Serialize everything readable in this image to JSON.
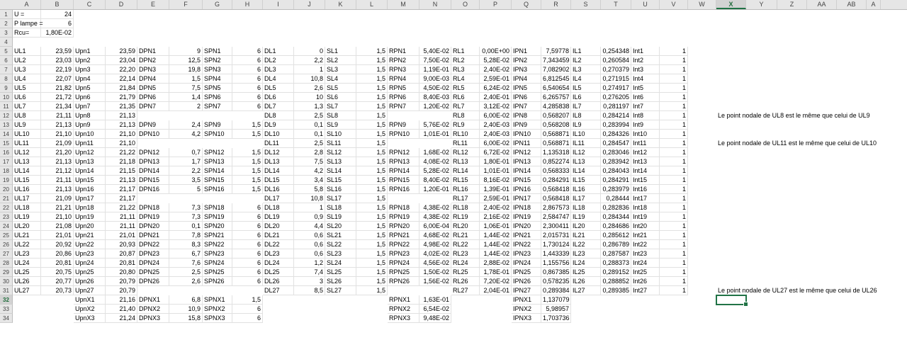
{
  "columns": [
    "A",
    "B",
    "C",
    "D",
    "E",
    "F",
    "G",
    "H",
    "I",
    "J",
    "K",
    "L",
    "M",
    "N",
    "O",
    "P",
    "Q",
    "R",
    "S",
    "T",
    "U",
    "V",
    "W",
    "X",
    "Y",
    "Z",
    "AA",
    "AB",
    "A"
  ],
  "selected_cell": "X32",
  "notes": {
    "r12": "Le point nodale de UL8 est le même que celui de UL9",
    "r15": "Le point nodale de UL11 est le même que celui de UL10",
    "r31": "Le point nodale de UL27 est le même que celui de UL26"
  },
  "rows": [
    {
      "n": "1",
      "c": [
        "U =",
        "24"
      ]
    },
    {
      "n": "2",
      "c": [
        "P lampe =",
        "6"
      ]
    },
    {
      "n": "3",
      "c": [
        "Rcu=",
        "1,80E-02"
      ]
    },
    {
      "n": "4",
      "c": []
    },
    {
      "n": "5",
      "c": [
        "UL1",
        "23,59",
        "Upn1",
        "23,59",
        "DPN1",
        "9",
        "SPN1",
        "6",
        "DL1",
        "0",
        "SL1",
        "1,5",
        "RPN1",
        "5,40E-02",
        "RL1",
        "0,00E+00",
        "IPN1",
        "7,59778",
        "IL1",
        "0,254348",
        "Int1",
        "1"
      ]
    },
    {
      "n": "6",
      "c": [
        "UL2",
        "23,03",
        "Upn2",
        "23,04",
        "DPN2",
        "12,5",
        "SPN2",
        "6",
        "DL2",
        "2,2",
        "SL2",
        "1,5",
        "RPN2",
        "7,50E-02",
        "RL2",
        "5,28E-02",
        "IPN2",
        "7,343459",
        "IL2",
        "0,260584",
        "Int2",
        "1"
      ]
    },
    {
      "n": "7",
      "c": [
        "UL3",
        "22,19",
        "Upn3",
        "22,20",
        "DPN3",
        "19,8",
        "SPN3",
        "6",
        "DL3",
        "1",
        "SL3",
        "1,5",
        "RPN3",
        "1,19E-01",
        "RL3",
        "2,40E-02",
        "IPN3",
        "7,082902",
        "IL3",
        "0,270379",
        "Int3",
        "1"
      ]
    },
    {
      "n": "8",
      "c": [
        "UL4",
        "22,07",
        "Upn4",
        "22,14",
        "DPN4",
        "1,5",
        "SPN4",
        "6",
        "DL4",
        "10,8",
        "SL4",
        "1,5",
        "RPN4",
        "9,00E-03",
        "RL4",
        "2,59E-01",
        "IPN4",
        "6,812545",
        "IL4",
        "0,271915",
        "Int4",
        "1"
      ]
    },
    {
      "n": "9",
      "c": [
        "UL5",
        "21,82",
        "Upn5",
        "21,84",
        "DPN5",
        "7,5",
        "SPN5",
        "6",
        "DL5",
        "2,6",
        "SL5",
        "1,5",
        "RPN5",
        "4,50E-02",
        "RL5",
        "6,24E-02",
        "IPN5",
        "6,540654",
        "IL5",
        "0,274917",
        "Int5",
        "1"
      ]
    },
    {
      "n": "10",
      "c": [
        "UL6",
        "21,72",
        "Upn6",
        "21,79",
        "DPN6",
        "1,4",
        "SPN6",
        "6",
        "DL6",
        "10",
        "SL6",
        "1,5",
        "RPN6",
        "8,40E-03",
        "RL6",
        "2,40E-01",
        "IPN6",
        "6,265757",
        "IL6",
        "0,276205",
        "Int6",
        "1"
      ]
    },
    {
      "n": "11",
      "c": [
        "UL7",
        "21,34",
        "Upn7",
        "21,35",
        "DPN7",
        "2",
        "SPN7",
        "6",
        "DL7",
        "1,3",
        "SL7",
        "1,5",
        "RPN7",
        "1,20E-02",
        "RL7",
        "3,12E-02",
        "IPN7",
        "4,285838",
        "IL7",
        "0,281197",
        "Int7",
        "1"
      ]
    },
    {
      "n": "12",
      "c": [
        "UL8",
        "21,11",
        "Upn8",
        "21,13",
        "",
        "",
        "",
        "",
        "DL8",
        "2,5",
        "SL8",
        "1,5",
        "",
        "",
        "RL8",
        "6,00E-02",
        "IPN8",
        "0,568207",
        "IL8",
        "0,284214",
        "Int8",
        "1"
      ]
    },
    {
      "n": "13",
      "c": [
        "UL9",
        "21,13",
        "Upn9",
        "21,13",
        "DPN9",
        "2,4",
        "SPN9",
        "1,5",
        "DL9",
        "0,1",
        "SL9",
        "1,5",
        "RPN9",
        "5,76E-02",
        "RL9",
        "2,40E-03",
        "IPN9",
        "0,568208",
        "IL9",
        "0,283994",
        "Int9",
        "1"
      ]
    },
    {
      "n": "14",
      "c": [
        "UL10",
        "21,10",
        "Upn10",
        "21,10",
        "DPN10",
        "4,2",
        "SPN10",
        "1,5",
        "DL10",
        "0,1",
        "SL10",
        "1,5",
        "RPN10",
        "1,01E-01",
        "RL10",
        "2,40E-03",
        "IPN10",
        "0,568871",
        "IL10",
        "0,284326",
        "Int10",
        "1"
      ]
    },
    {
      "n": "15",
      "c": [
        "UL11",
        "21,09",
        "Upn11",
        "21,10",
        "",
        "",
        "",
        "",
        "DL11",
        "2,5",
        "SL11",
        "1,5",
        "",
        "",
        "RL11",
        "6,00E-02",
        "IPN11",
        "0,568871",
        "IL11",
        "0,284547",
        "Int11",
        "1"
      ]
    },
    {
      "n": "16",
      "c": [
        "UL12",
        "21,20",
        "Upn12",
        "21,22",
        "DPN12",
        "0,7",
        "SPN12",
        "1,5",
        "DL12",
        "2,8",
        "SL12",
        "1,5",
        "RPN12",
        "1,68E-02",
        "RL12",
        "6,72E-02",
        "IPN12",
        "1,135318",
        "IL12",
        "0,283046",
        "Int12",
        "1"
      ]
    },
    {
      "n": "17",
      "c": [
        "UL13",
        "21,13",
        "Upn13",
        "21,18",
        "DPN13",
        "1,7",
        "SPN13",
        "1,5",
        "DL13",
        "7,5",
        "SL13",
        "1,5",
        "RPN13",
        "4,08E-02",
        "RL13",
        "1,80E-01",
        "IPN13",
        "0,852274",
        "IL13",
        "0,283942",
        "Int13",
        "1"
      ]
    },
    {
      "n": "18",
      "c": [
        "UL14",
        "21,12",
        "Upn14",
        "21,15",
        "DPN14",
        "2,2",
        "SPN14",
        "1,5",
        "DL14",
        "4,2",
        "SL14",
        "1,5",
        "RPN14",
        "5,28E-02",
        "RL14",
        "1,01E-01",
        "IPN14",
        "0,568333",
        "IL14",
        "0,284043",
        "Int14",
        "1"
      ]
    },
    {
      "n": "19",
      "c": [
        "UL15",
        "21,11",
        "Upn15",
        "21,13",
        "DPN15",
        "3,5",
        "SPN15",
        "1,5",
        "DL15",
        "3,4",
        "SL15",
        "1,5",
        "RPN15",
        "8,40E-02",
        "RL15",
        "8,16E-02",
        "IPN15",
        "0,284291",
        "IL15",
        "0,284291",
        "Int15",
        "1"
      ]
    },
    {
      "n": "20",
      "c": [
        "UL16",
        "21,13",
        "Upn16",
        "21,17",
        "DPN16",
        "5",
        "SPN16",
        "1,5",
        "DL16",
        "5,8",
        "SL16",
        "1,5",
        "RPN16",
        "1,20E-01",
        "RL16",
        "1,39E-01",
        "IPN16",
        "0,568418",
        "IL16",
        "0,283979",
        "Int16",
        "1"
      ]
    },
    {
      "n": "21",
      "c": [
        "UL17",
        "21,09",
        "Upn17",
        "21,17",
        "",
        "",
        "",
        "",
        "DL17",
        "10,8",
        "SL17",
        "1,5",
        "",
        "",
        "RL17",
        "2,59E-01",
        "IPN17",
        "0,568418",
        "IL17",
        "0,28444",
        "Int17",
        "1"
      ]
    },
    {
      "n": "22",
      "c": [
        "UL18",
        "21,21",
        "Upn18",
        "21,22",
        "DPN18",
        "7,3",
        "SPN18",
        "6",
        "DL18",
        "1",
        "SL18",
        "1,5",
        "RPN18",
        "4,38E-02",
        "RL18",
        "2,40E-02",
        "IPN18",
        "2,867573",
        "IL18",
        "0,282836",
        "Int18",
        "1"
      ]
    },
    {
      "n": "23",
      "c": [
        "UL19",
        "21,10",
        "Upn19",
        "21,11",
        "DPN19",
        "7,3",
        "SPN19",
        "6",
        "DL19",
        "0,9",
        "SL19",
        "1,5",
        "RPN19",
        "4,38E-02",
        "RL19",
        "2,16E-02",
        "IPN19",
        "2,584747",
        "IL19",
        "0,284344",
        "Int19",
        "1"
      ]
    },
    {
      "n": "24",
      "c": [
        "UL20",
        "21,08",
        "Upn20",
        "21,11",
        "DPN20",
        "0,1",
        "SPN20",
        "6",
        "DL20",
        "4,4",
        "SL20",
        "1,5",
        "RPN20",
        "6,00E-04",
        "RL20",
        "1,06E-01",
        "IPN20",
        "2,300411",
        "IL20",
        "0,284686",
        "Int20",
        "1"
      ]
    },
    {
      "n": "25",
      "c": [
        "UL21",
        "21,01",
        "Upn21",
        "21,01",
        "DPN21",
        "7,8",
        "SPN21",
        "6",
        "DL21",
        "0,6",
        "SL21",
        "1,5",
        "RPN21",
        "4,68E-02",
        "RL21",
        "1,44E-02",
        "IPN21",
        "2,015731",
        "IL21",
        "0,285612",
        "Int21",
        "1"
      ]
    },
    {
      "n": "26",
      "c": [
        "UL22",
        "20,92",
        "Upn22",
        "20,93",
        "DPN22",
        "8,3",
        "SPN22",
        "6",
        "DL22",
        "0,6",
        "SL22",
        "1,5",
        "RPN22",
        "4,98E-02",
        "RL22",
        "1,44E-02",
        "IPN22",
        "1,730124",
        "IL22",
        "0,286789",
        "Int22",
        "1"
      ]
    },
    {
      "n": "27",
      "c": [
        "UL23",
        "20,86",
        "Upn23",
        "20,87",
        "DPN23",
        "6,7",
        "SPN23",
        "6",
        "DL23",
        "0,6",
        "SL23",
        "1,5",
        "RPN23",
        "4,02E-02",
        "RL23",
        "1,44E-02",
        "IPN23",
        "1,443339",
        "IL23",
        "0,287587",
        "Int23",
        "1"
      ]
    },
    {
      "n": "28",
      "c": [
        "UL24",
        "20,81",
        "Upn24",
        "20,81",
        "DPN24",
        "7,6",
        "SPN24",
        "6",
        "DL24",
        "1,2",
        "SL24",
        "1,5",
        "RPN24",
        "4,56E-02",
        "RL24",
        "2,88E-02",
        "IPN24",
        "1,155756",
        "IL24",
        "0,288373",
        "Int24",
        "1"
      ]
    },
    {
      "n": "29",
      "c": [
        "UL25",
        "20,75",
        "Upn25",
        "20,80",
        "DPN25",
        "2,5",
        "SPN25",
        "6",
        "DL25",
        "7,4",
        "SL25",
        "1,5",
        "RPN25",
        "1,50E-02",
        "RL25",
        "1,78E-01",
        "IPN25",
        "0,867385",
        "IL25",
        "0,289152",
        "Int25",
        "1"
      ]
    },
    {
      "n": "30",
      "c": [
        "UL26",
        "20,77",
        "Upn26",
        "20,79",
        "DPN26",
        "2,6",
        "SPN26",
        "6",
        "DL26",
        "3",
        "SL26",
        "1,5",
        "RPN26",
        "1,56E-02",
        "RL26",
        "7,20E-02",
        "IPN26",
        "0,578235",
        "IL26",
        "0,288852",
        "Int26",
        "1"
      ]
    },
    {
      "n": "31",
      "c": [
        "UL27",
        "20,73",
        "Upn27",
        "20,79",
        "",
        "",
        "",
        "",
        "DL27",
        "8,5",
        "SL27",
        "1,5",
        "",
        "",
        "RL27",
        "2,04E-01",
        "IPN27",
        "0,289384",
        "IL27",
        "0,289385",
        "Int27",
        "1"
      ]
    },
    {
      "n": "32",
      "c": [
        "",
        "",
        "UpnX1",
        "21,16",
        "DPNX1",
        "6,8",
        "SPNX1",
        "1,5",
        "",
        "",
        "",
        "",
        "RPNX1",
        "1,63E-01",
        "",
        "",
        "IPNX1",
        "1,137079"
      ]
    },
    {
      "n": "33",
      "c": [
        "",
        "",
        "UpnX2",
        "21,40",
        "DPNX2",
        "10,9",
        "SPNX2",
        "6",
        "",
        "",
        "",
        "",
        "RPNX2",
        "6,54E-02",
        "",
        "",
        "IPNX2",
        "5,98957"
      ]
    },
    {
      "n": "34",
      "c": [
        "",
        "",
        "UpnX3",
        "21,24",
        "DPNX3",
        "15,8",
        "SPNX3",
        "6",
        "",
        "",
        "",
        "",
        "RPNX3",
        "9,48E-02",
        "",
        "",
        "IPNX3",
        "1,703736"
      ]
    }
  ]
}
